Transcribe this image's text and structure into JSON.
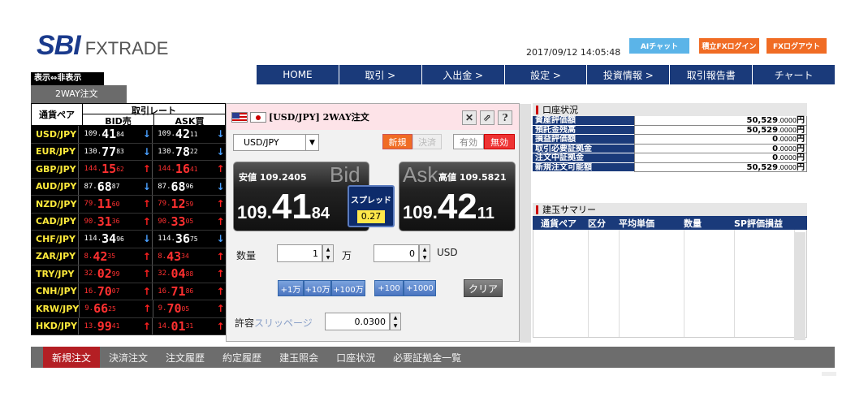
{
  "header": {
    "brand": "SBI",
    "product": "FXTRADE",
    "datetime": "2017/09/12 14:05:48",
    "btn_ai": "AIチャット",
    "btn_tsumitate": "積立FXログイン",
    "btn_logout": "FXログアウト"
  },
  "nav": [
    "HOME",
    "取引 >",
    "入出金 >",
    "設定 >",
    "投資情報 >",
    "取引報告書",
    "チャート"
  ],
  "toggle": "表示⇔非表示",
  "tab": "2WAY注文",
  "rates": {
    "h_pair": "通貨ペア",
    "h_rate": "取引レート",
    "h_bid": "BID売",
    "h_ask": "ASK買",
    "rows": [
      {
        "pair": "USD/JPY",
        "bid": [
          "109.",
          "41",
          "84"
        ],
        "ask": [
          "109.",
          "42",
          "11"
        ],
        "dir": "down",
        "color": "white"
      },
      {
        "pair": "EUR/JPY",
        "bid": [
          "130.",
          "77",
          "83"
        ],
        "ask": [
          "130.",
          "78",
          "22"
        ],
        "dir": "down",
        "color": "white"
      },
      {
        "pair": "GBP/JPY",
        "bid": [
          "144.",
          "15",
          "62"
        ],
        "ask": [
          "144.",
          "16",
          "41"
        ],
        "dir": "up",
        "color": "red"
      },
      {
        "pair": "AUD/JPY",
        "bid": [
          "87.",
          "68",
          "87"
        ],
        "ask": [
          "87.",
          "68",
          "96"
        ],
        "dir": "down",
        "color": "white"
      },
      {
        "pair": "NZD/JPY",
        "bid": [
          "79.",
          "11",
          "60"
        ],
        "ask": [
          "79.",
          "12",
          "59"
        ],
        "dir": "up",
        "color": "red"
      },
      {
        "pair": "CAD/JPY",
        "bid": [
          "90.",
          "31",
          "36"
        ],
        "ask": [
          "90.",
          "33",
          "05"
        ],
        "dir": "up",
        "color": "red"
      },
      {
        "pair": "CHF/JPY",
        "bid": [
          "114.",
          "34",
          "96"
        ],
        "ask": [
          "114.",
          "36",
          "75"
        ],
        "dir": "down",
        "color": "white"
      },
      {
        "pair": "ZAR/JPY",
        "bid": [
          "8.",
          "42",
          "35"
        ],
        "ask": [
          "8.",
          "43",
          "34"
        ],
        "dir": "up",
        "color": "red"
      },
      {
        "pair": "TRY/JPY",
        "bid": [
          "32.",
          "02",
          "99"
        ],
        "ask": [
          "32.",
          "04",
          "88"
        ],
        "dir": "up",
        "color": "red"
      },
      {
        "pair": "CNH/JPY",
        "bid": [
          "16.",
          "70",
          "07"
        ],
        "ask": [
          "16.",
          "71",
          "86"
        ],
        "dir": "up",
        "color": "red"
      },
      {
        "pair": "KRW/JPY",
        "bid": [
          "9.",
          "66",
          "25"
        ],
        "ask": [
          "9.",
          "70",
          "05"
        ],
        "dir": "up",
        "color": "red"
      },
      {
        "pair": "HKD/JPY",
        "bid": [
          "13.",
          "99",
          "41"
        ],
        "ask": [
          "14.",
          "01",
          "31"
        ],
        "dir": "up",
        "color": "red"
      }
    ]
  },
  "order": {
    "title": "[USD/JPY] 2WAY注文",
    "pair": "USD/JPY",
    "btn_new": "新規",
    "btn_settle": "決済",
    "btn_yes": "有効",
    "btn_no": "無効",
    "low_label": "安値",
    "low": "109.2405",
    "high_label": "高値",
    "high": "109.5821",
    "bid_wm": "Bid",
    "ask_wm": "Ask",
    "bid": [
      "109.",
      "41",
      "84"
    ],
    "ask": [
      "109.",
      "42",
      "11"
    ],
    "spread_label": "スプレッド",
    "spread": "0.27",
    "qty_label": "数量",
    "qty": "1",
    "qty_unit": "万",
    "usd_qty": "0",
    "usd": "USD",
    "qbtns": [
      "+1万",
      "+10万",
      "+100万",
      "+100",
      "+1000"
    ],
    "clear": "クリア",
    "slip_label1": "許容",
    "slip_label2": "スリッページ",
    "slip": "0.0300"
  },
  "account": {
    "title": "口座状況",
    "rows": [
      {
        "k": "資産評価額",
        "v": "50,529",
        "d": ".0000",
        "u": "円"
      },
      {
        "k": "預託金残高",
        "v": "50,529",
        "d": ".0000",
        "u": "円"
      },
      {
        "k": "損益評価額",
        "v": "0",
        "d": ".0000",
        "u": "円"
      },
      {
        "k": "取引必要証拠金",
        "v": "0",
        "d": ".0000",
        "u": "円"
      },
      {
        "k": "注文中証拠金",
        "v": "0",
        "d": ".0000",
        "u": "円"
      },
      {
        "k": "新規注文可能額",
        "v": "50,529",
        "d": ".0000",
        "u": "円"
      }
    ]
  },
  "summary": {
    "title": "建玉サマリー",
    "cols": [
      "通貨ペア",
      "区分",
      "平均単価",
      "数量",
      "SP評価損益"
    ]
  },
  "bottom": [
    "新規注文",
    "決済注文",
    "注文履歴",
    "約定履歴",
    "建玉照会",
    "口座状況",
    "必要証拠金一覧"
  ],
  "colors": {
    "navy": "#1a3a7a",
    "orange": "#f06c24",
    "red": "#b41f24"
  }
}
